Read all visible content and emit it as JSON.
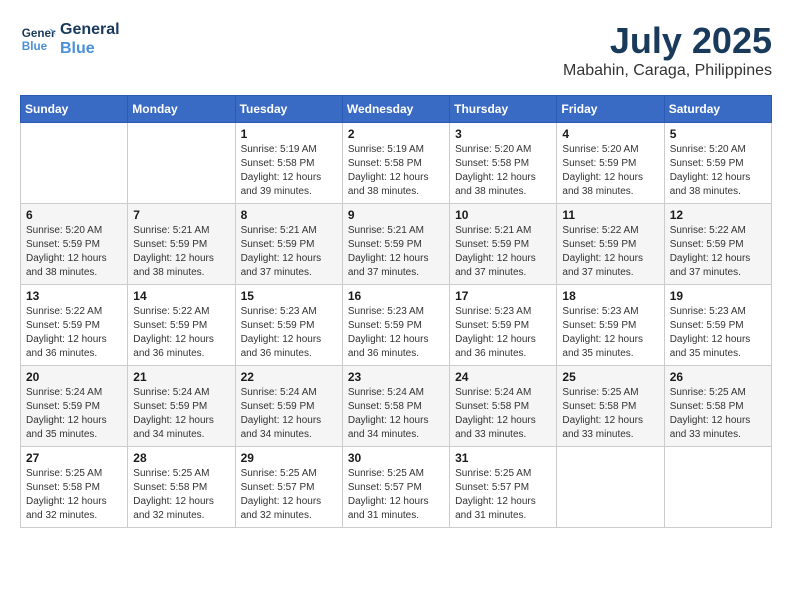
{
  "header": {
    "logo_line1": "General",
    "logo_line2": "Blue",
    "month": "July 2025",
    "location": "Mabahin, Caraga, Philippines"
  },
  "days_of_week": [
    "Sunday",
    "Monday",
    "Tuesday",
    "Wednesday",
    "Thursday",
    "Friday",
    "Saturday"
  ],
  "weeks": [
    [
      {
        "day": "",
        "info": ""
      },
      {
        "day": "",
        "info": ""
      },
      {
        "day": "1",
        "info": "Sunrise: 5:19 AM\nSunset: 5:58 PM\nDaylight: 12 hours and 39 minutes."
      },
      {
        "day": "2",
        "info": "Sunrise: 5:19 AM\nSunset: 5:58 PM\nDaylight: 12 hours and 38 minutes."
      },
      {
        "day": "3",
        "info": "Sunrise: 5:20 AM\nSunset: 5:58 PM\nDaylight: 12 hours and 38 minutes."
      },
      {
        "day": "4",
        "info": "Sunrise: 5:20 AM\nSunset: 5:59 PM\nDaylight: 12 hours and 38 minutes."
      },
      {
        "day": "5",
        "info": "Sunrise: 5:20 AM\nSunset: 5:59 PM\nDaylight: 12 hours and 38 minutes."
      }
    ],
    [
      {
        "day": "6",
        "info": "Sunrise: 5:20 AM\nSunset: 5:59 PM\nDaylight: 12 hours and 38 minutes."
      },
      {
        "day": "7",
        "info": "Sunrise: 5:21 AM\nSunset: 5:59 PM\nDaylight: 12 hours and 38 minutes."
      },
      {
        "day": "8",
        "info": "Sunrise: 5:21 AM\nSunset: 5:59 PM\nDaylight: 12 hours and 37 minutes."
      },
      {
        "day": "9",
        "info": "Sunrise: 5:21 AM\nSunset: 5:59 PM\nDaylight: 12 hours and 37 minutes."
      },
      {
        "day": "10",
        "info": "Sunrise: 5:21 AM\nSunset: 5:59 PM\nDaylight: 12 hours and 37 minutes."
      },
      {
        "day": "11",
        "info": "Sunrise: 5:22 AM\nSunset: 5:59 PM\nDaylight: 12 hours and 37 minutes."
      },
      {
        "day": "12",
        "info": "Sunrise: 5:22 AM\nSunset: 5:59 PM\nDaylight: 12 hours and 37 minutes."
      }
    ],
    [
      {
        "day": "13",
        "info": "Sunrise: 5:22 AM\nSunset: 5:59 PM\nDaylight: 12 hours and 36 minutes."
      },
      {
        "day": "14",
        "info": "Sunrise: 5:22 AM\nSunset: 5:59 PM\nDaylight: 12 hours and 36 minutes."
      },
      {
        "day": "15",
        "info": "Sunrise: 5:23 AM\nSunset: 5:59 PM\nDaylight: 12 hours and 36 minutes."
      },
      {
        "day": "16",
        "info": "Sunrise: 5:23 AM\nSunset: 5:59 PM\nDaylight: 12 hours and 36 minutes."
      },
      {
        "day": "17",
        "info": "Sunrise: 5:23 AM\nSunset: 5:59 PM\nDaylight: 12 hours and 36 minutes."
      },
      {
        "day": "18",
        "info": "Sunrise: 5:23 AM\nSunset: 5:59 PM\nDaylight: 12 hours and 35 minutes."
      },
      {
        "day": "19",
        "info": "Sunrise: 5:23 AM\nSunset: 5:59 PM\nDaylight: 12 hours and 35 minutes."
      }
    ],
    [
      {
        "day": "20",
        "info": "Sunrise: 5:24 AM\nSunset: 5:59 PM\nDaylight: 12 hours and 35 minutes."
      },
      {
        "day": "21",
        "info": "Sunrise: 5:24 AM\nSunset: 5:59 PM\nDaylight: 12 hours and 34 minutes."
      },
      {
        "day": "22",
        "info": "Sunrise: 5:24 AM\nSunset: 5:59 PM\nDaylight: 12 hours and 34 minutes."
      },
      {
        "day": "23",
        "info": "Sunrise: 5:24 AM\nSunset: 5:58 PM\nDaylight: 12 hours and 34 minutes."
      },
      {
        "day": "24",
        "info": "Sunrise: 5:24 AM\nSunset: 5:58 PM\nDaylight: 12 hours and 33 minutes."
      },
      {
        "day": "25",
        "info": "Sunrise: 5:25 AM\nSunset: 5:58 PM\nDaylight: 12 hours and 33 minutes."
      },
      {
        "day": "26",
        "info": "Sunrise: 5:25 AM\nSunset: 5:58 PM\nDaylight: 12 hours and 33 minutes."
      }
    ],
    [
      {
        "day": "27",
        "info": "Sunrise: 5:25 AM\nSunset: 5:58 PM\nDaylight: 12 hours and 32 minutes."
      },
      {
        "day": "28",
        "info": "Sunrise: 5:25 AM\nSunset: 5:58 PM\nDaylight: 12 hours and 32 minutes."
      },
      {
        "day": "29",
        "info": "Sunrise: 5:25 AM\nSunset: 5:57 PM\nDaylight: 12 hours and 32 minutes."
      },
      {
        "day": "30",
        "info": "Sunrise: 5:25 AM\nSunset: 5:57 PM\nDaylight: 12 hours and 31 minutes."
      },
      {
        "day": "31",
        "info": "Sunrise: 5:25 AM\nSunset: 5:57 PM\nDaylight: 12 hours and 31 minutes."
      },
      {
        "day": "",
        "info": ""
      },
      {
        "day": "",
        "info": ""
      }
    ]
  ]
}
